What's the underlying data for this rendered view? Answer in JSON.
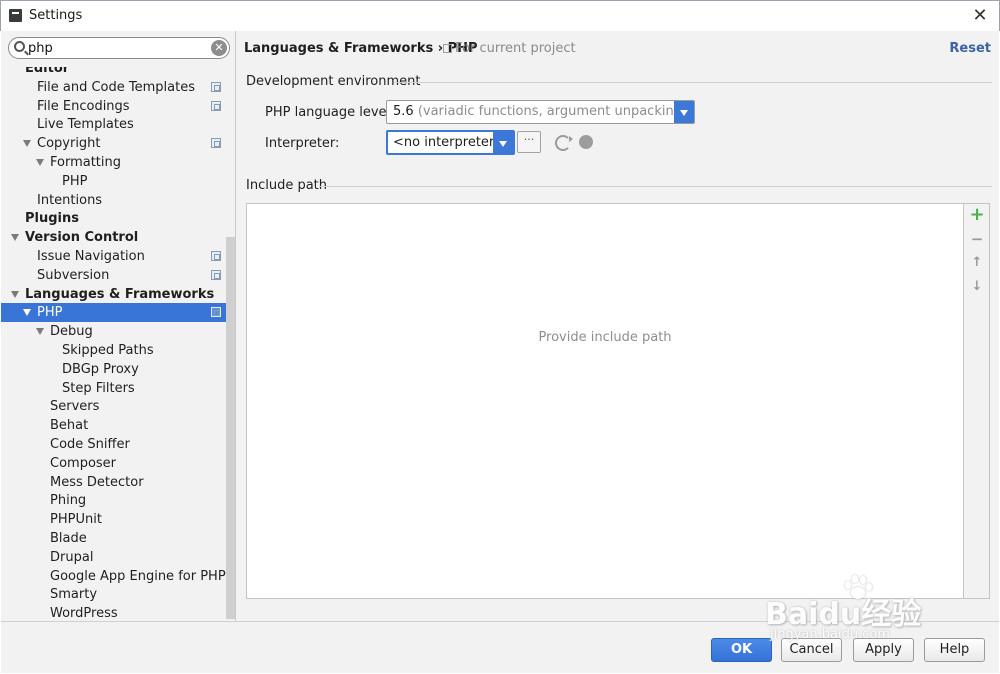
{
  "window": {
    "title": "Settings",
    "close_glyph": "✕"
  },
  "search": {
    "value": "php",
    "clear_glyph": "✕"
  },
  "tree": [
    {
      "label": "Editor",
      "level": 0,
      "bold": true,
      "expanded": null,
      "project": false
    },
    {
      "label": "File and Code Templates",
      "level": 1,
      "bold": false,
      "expanded": null,
      "project": true
    },
    {
      "label": "File Encodings",
      "level": 1,
      "bold": false,
      "expanded": null,
      "project": true
    },
    {
      "label": "Live Templates",
      "level": 1,
      "bold": false,
      "expanded": null,
      "project": false
    },
    {
      "label": "Copyright",
      "level": 1,
      "bold": false,
      "expanded": true,
      "project": true
    },
    {
      "label": "Formatting",
      "level": 2,
      "bold": false,
      "expanded": true,
      "project": false
    },
    {
      "label": "PHP",
      "level": 3,
      "bold": false,
      "expanded": null,
      "project": false
    },
    {
      "label": "Intentions",
      "level": 1,
      "bold": false,
      "expanded": null,
      "project": false
    },
    {
      "label": "Plugins",
      "level": 0,
      "bold": true,
      "expanded": null,
      "project": false
    },
    {
      "label": "Version Control",
      "level": 0,
      "bold": true,
      "expanded": true,
      "project": false
    },
    {
      "label": "Issue Navigation",
      "level": 1,
      "bold": false,
      "expanded": null,
      "project": true
    },
    {
      "label": "Subversion",
      "level": 1,
      "bold": false,
      "expanded": null,
      "project": true
    },
    {
      "label": "Languages & Frameworks",
      "level": 0,
      "bold": true,
      "expanded": true,
      "project": false
    },
    {
      "label": "PHP",
      "level": 1,
      "bold": false,
      "expanded": true,
      "project": true,
      "selected": true
    },
    {
      "label": "Debug",
      "level": 2,
      "bold": false,
      "expanded": true,
      "project": false
    },
    {
      "label": "Skipped Paths",
      "level": 3,
      "bold": false,
      "expanded": null,
      "project": false
    },
    {
      "label": "DBGp Proxy",
      "level": 3,
      "bold": false,
      "expanded": null,
      "project": false
    },
    {
      "label": "Step Filters",
      "level": 3,
      "bold": false,
      "expanded": null,
      "project": false
    },
    {
      "label": "Servers",
      "level": 2,
      "bold": false,
      "expanded": null,
      "project": false
    },
    {
      "label": "Behat",
      "level": 2,
      "bold": false,
      "expanded": null,
      "project": false
    },
    {
      "label": "Code Sniffer",
      "level": 2,
      "bold": false,
      "expanded": null,
      "project": false
    },
    {
      "label": "Composer",
      "level": 2,
      "bold": false,
      "expanded": null,
      "project": false
    },
    {
      "label": "Mess Detector",
      "level": 2,
      "bold": false,
      "expanded": null,
      "project": false
    },
    {
      "label": "Phing",
      "level": 2,
      "bold": false,
      "expanded": null,
      "project": false
    },
    {
      "label": "PHPUnit",
      "level": 2,
      "bold": false,
      "expanded": null,
      "project": false
    },
    {
      "label": "Blade",
      "level": 2,
      "bold": false,
      "expanded": null,
      "project": false
    },
    {
      "label": "Drupal",
      "level": 2,
      "bold": false,
      "expanded": null,
      "project": false
    },
    {
      "label": "Google App Engine for PHP",
      "level": 2,
      "bold": false,
      "expanded": null,
      "project": false
    },
    {
      "label": "Smarty",
      "level": 2,
      "bold": false,
      "expanded": null,
      "project": false
    },
    {
      "label": "WordPress",
      "level": 2,
      "bold": false,
      "expanded": null,
      "project": false
    }
  ],
  "header": {
    "breadcrumb": "Languages & Frameworks › PHP",
    "scope": "For current project",
    "reset_label": "Reset"
  },
  "dev_env": {
    "section_title": "Development environment",
    "level_label": "PHP language level:",
    "level_value": "5.6",
    "level_hint": "(variadic functions, argument unpacking, etc.)",
    "interpreter_label": "Interpreter:",
    "interpreter_value": "<no interpreter>",
    "browse_label": "···"
  },
  "include": {
    "section_title": "Include path",
    "empty_text": "Provide include path",
    "tools": [
      "+",
      "−",
      "↑",
      "↓"
    ]
  },
  "footer": {
    "ok_label": "OK",
    "cancel_label": "Cancel",
    "apply_label": "Apply",
    "help_label": "Help"
  },
  "watermark": {
    "main": "Baidu经验",
    "sub": "jingyan.baidu.com"
  },
  "colors": {
    "selection": "#3875d7",
    "accent": "#3b78d8",
    "reset_link": "#3c63a8",
    "add_green": "#4caf50"
  }
}
